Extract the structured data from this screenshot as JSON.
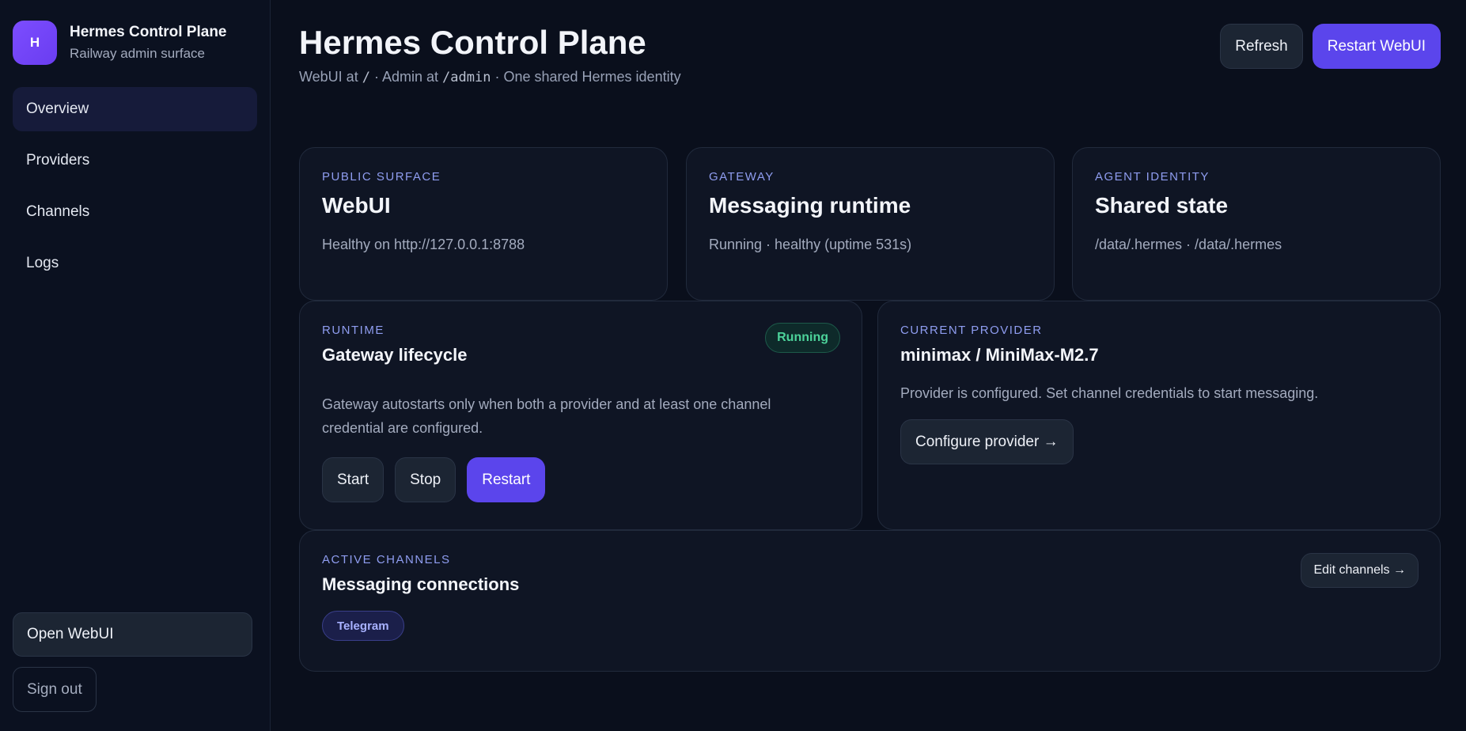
{
  "sidebar": {
    "brand_initial": "H",
    "brand_title": "Hermes Control Plane",
    "brand_subtitle": "Railway admin surface",
    "items": [
      {
        "label": "Overview",
        "active": true
      },
      {
        "label": "Providers",
        "active": false
      },
      {
        "label": "Channels",
        "active": false
      },
      {
        "label": "Logs",
        "active": false
      }
    ],
    "open_webui": "Open WebUI",
    "sign_out": "Sign out"
  },
  "header": {
    "title": "Hermes Control Plane",
    "subtitle_prefix": "WebUI at",
    "subtitle_root": "/",
    "subtitle_mid": "· Admin at",
    "subtitle_admin": "/admin",
    "subtitle_suffix": "· One shared Hermes identity",
    "refresh_label": "Refresh",
    "restart_label": "Restart WebUI"
  },
  "cards": {
    "public_surface": {
      "eyebrow": "PUBLIC SURFACE",
      "title": "WebUI",
      "text": "Healthy on http://127.0.0.1:8788"
    },
    "gateway": {
      "eyebrow": "GATEWAY",
      "title": "Messaging runtime",
      "text": "Running · healthy (uptime 531s)"
    },
    "agent_identity": {
      "eyebrow": "AGENT IDENTITY",
      "title": "Shared state",
      "text": "/data/.hermes · /data/.hermes"
    },
    "runtime": {
      "eyebrow": "RUNTIME",
      "title": "Gateway lifecycle",
      "status": "Running",
      "text": "Gateway autostarts only when both a provider and at least one channel credential are configured.",
      "start": "Start",
      "stop": "Stop",
      "restart": "Restart"
    },
    "provider": {
      "eyebrow": "CURRENT PROVIDER",
      "title": "minimax / MiniMax-M2.7",
      "text": "Provider is configured. Set channel credentials to start messaging.",
      "button": "Configure provider →"
    },
    "channels": {
      "eyebrow": "ACTIVE CHANNELS",
      "title": "Messaging connections",
      "chip": "Telegram",
      "button": "Edit channels →"
    }
  },
  "colors": {
    "accent": "#5b45ec",
    "brand_badge": "#7c4dff",
    "status_green": "#4cd39a",
    "eyebrow": "#8f9df0"
  }
}
